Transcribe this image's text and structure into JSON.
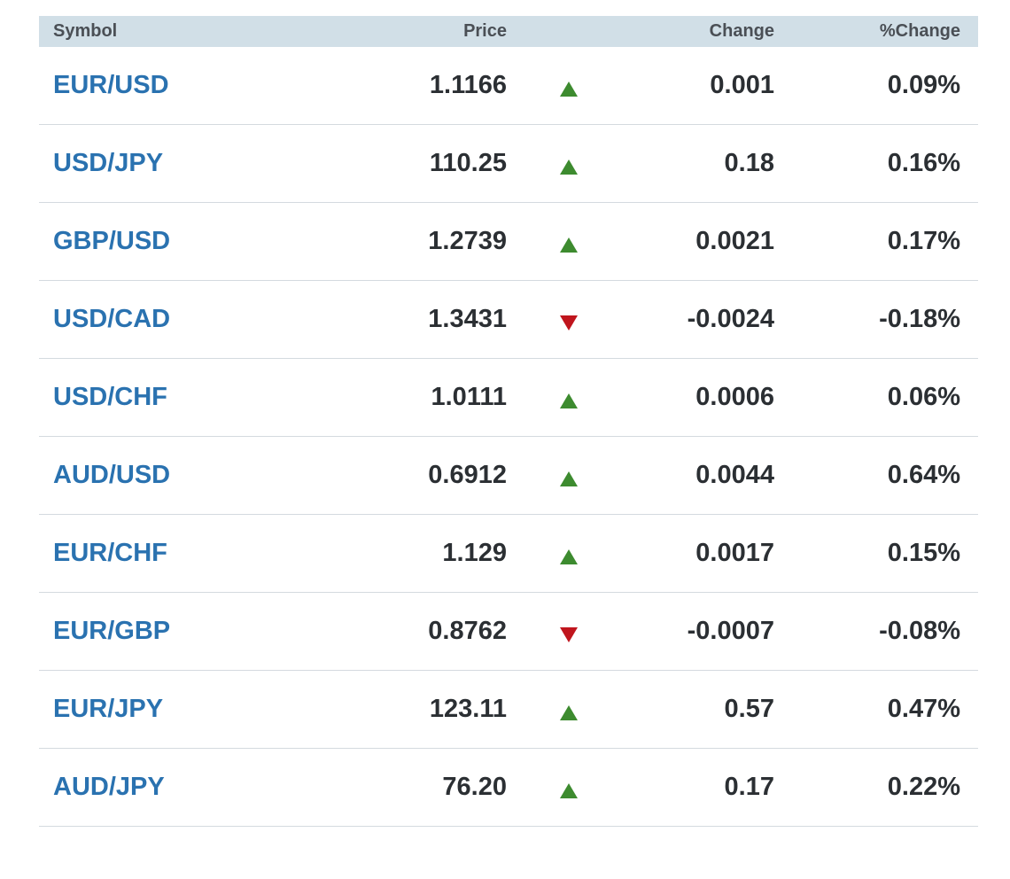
{
  "table": {
    "headers": {
      "symbol": "Symbol",
      "price": "Price",
      "change": "Change",
      "pct_change": "%Change"
    },
    "colors": {
      "up": "#3d8b2f",
      "down": "#c0151d",
      "symbol_link": "#2a72b0",
      "header_bg": "#d1dfe7"
    },
    "rows": [
      {
        "symbol": "EUR/USD",
        "price": "1.1166",
        "direction": "up",
        "change": "0.001",
        "pct_change": "0.09%"
      },
      {
        "symbol": "USD/JPY",
        "price": "110.25",
        "direction": "up",
        "change": "0.18",
        "pct_change": "0.16%"
      },
      {
        "symbol": "GBP/USD",
        "price": "1.2739",
        "direction": "up",
        "change": "0.0021",
        "pct_change": "0.17%"
      },
      {
        "symbol": "USD/CAD",
        "price": "1.3431",
        "direction": "down",
        "change": "-0.0024",
        "pct_change": "-0.18%"
      },
      {
        "symbol": "USD/CHF",
        "price": "1.0111",
        "direction": "up",
        "change": "0.0006",
        "pct_change": "0.06%"
      },
      {
        "symbol": "AUD/USD",
        "price": "0.6912",
        "direction": "up",
        "change": "0.0044",
        "pct_change": "0.64%"
      },
      {
        "symbol": "EUR/CHF",
        "price": "1.129",
        "direction": "up",
        "change": "0.0017",
        "pct_change": "0.15%"
      },
      {
        "symbol": "EUR/GBP",
        "price": "0.8762",
        "direction": "down",
        "change": "-0.0007",
        "pct_change": "-0.08%"
      },
      {
        "symbol": "EUR/JPY",
        "price": "123.11",
        "direction": "up",
        "change": "0.57",
        "pct_change": "0.47%"
      },
      {
        "symbol": "AUD/JPY",
        "price": "76.20",
        "direction": "up",
        "change": "0.17",
        "pct_change": "0.22%"
      }
    ]
  }
}
